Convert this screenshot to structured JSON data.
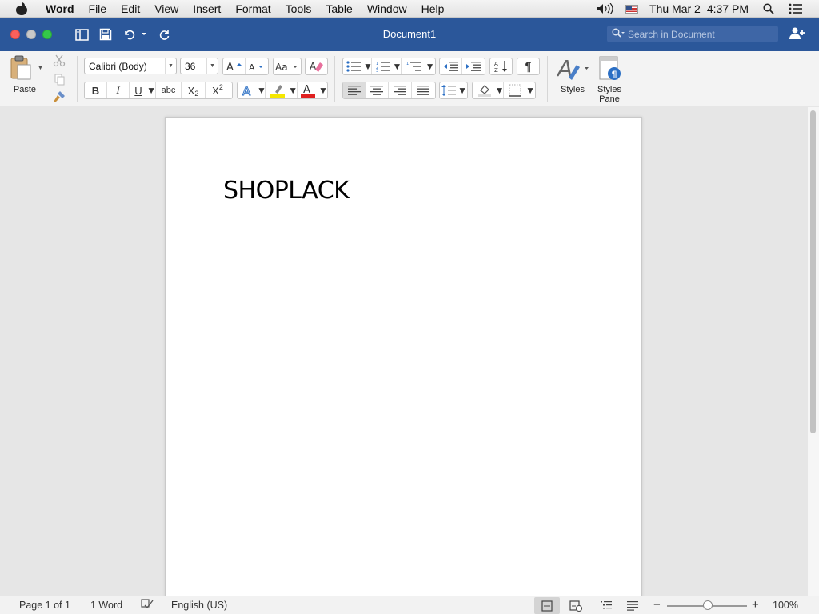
{
  "menubar": {
    "app_name": "Word",
    "items": [
      "File",
      "Edit",
      "View",
      "Insert",
      "Format",
      "Tools",
      "Table",
      "Window",
      "Help"
    ],
    "date": "Thu Mar 2",
    "time": "4:37 PM"
  },
  "titlebar": {
    "title": "Document1",
    "search_placeholder": "Search in Document"
  },
  "ribbon": {
    "paste_label": "Paste",
    "font_name": "Calibri (Body)",
    "font_size": "36",
    "bold": "B",
    "italic": "I",
    "underline": "U",
    "strike": "abc",
    "subscript": "X",
    "superscript": "X",
    "pilcrow": "¶",
    "styles_label": "Styles",
    "styles_pane_label": "Styles Pane",
    "highlight_color": "#f5e700",
    "font_color": "#e02020"
  },
  "document": {
    "text": "SHOPLACK"
  },
  "statusbar": {
    "page": "Page 1 of 1",
    "words": "1 Word",
    "language": "English (US)",
    "zoom": "100%",
    "zoom_level": 1.0
  },
  "colors": {
    "title_blue": "#2b579a"
  }
}
